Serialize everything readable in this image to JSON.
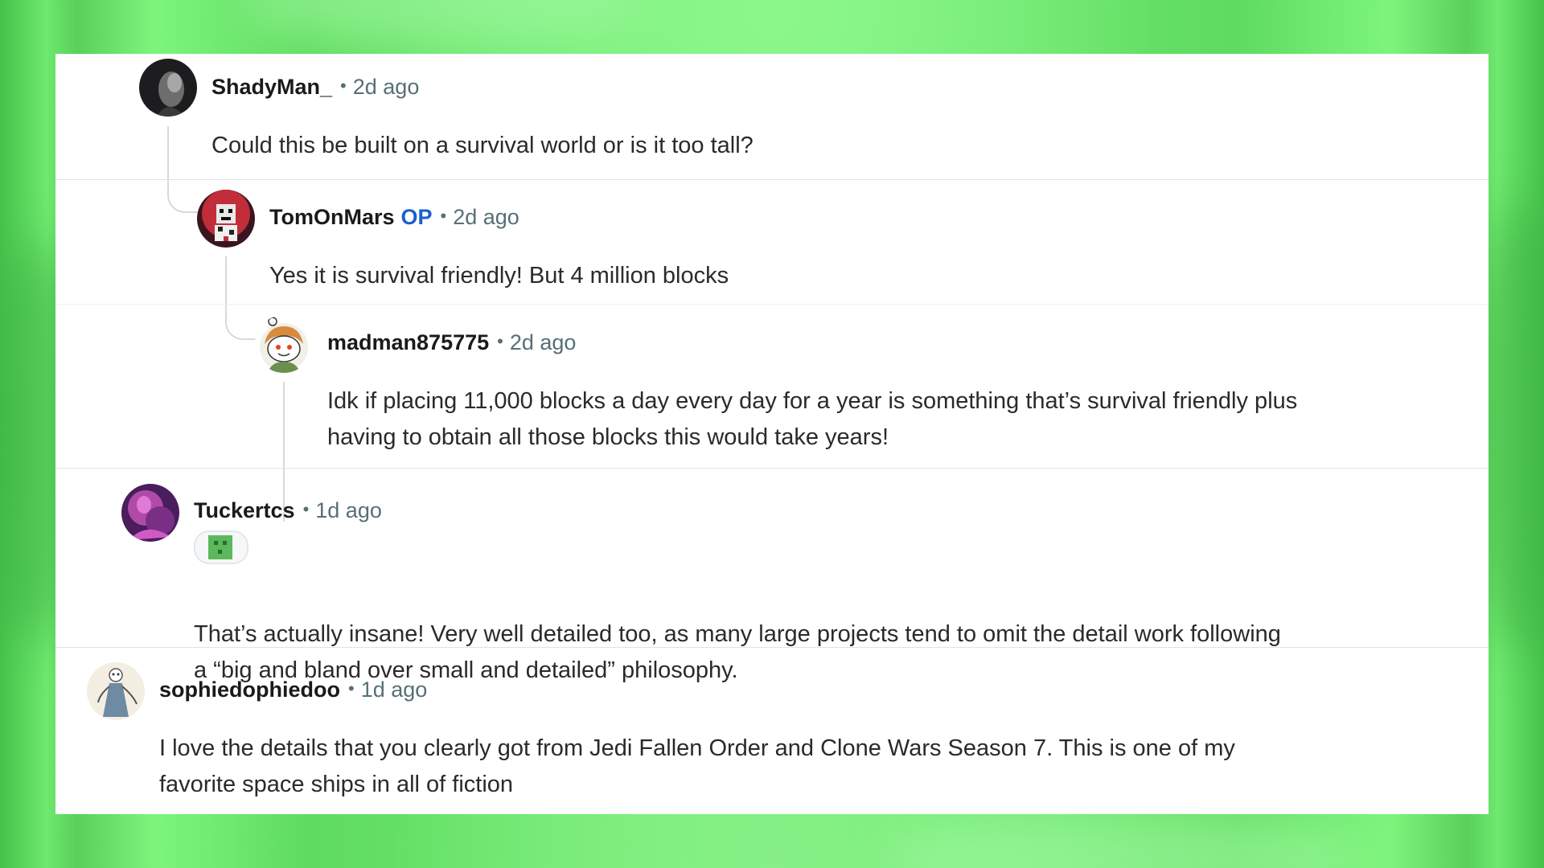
{
  "comments": [
    {
      "username": "ShadyMan_",
      "op_badge": "",
      "time": "2d ago",
      "text": "Could this be built on a survival world or is it too tall?",
      "avatar_icon": "dark-portrait-avatar"
    },
    {
      "username": "TomOnMars",
      "op_badge": "OP",
      "time": "2d ago",
      "text": "Yes it is survival friendly! But 4 million blocks",
      "avatar_icon": "red-pixel-avatar"
    },
    {
      "username": "madman875775",
      "op_badge": "",
      "time": "2d ago",
      "text_line1": "Idk if placing 11,000 blocks a day every day for a year is something that’s survival friendly plus",
      "text_line2": "having to obtain all those blocks this would take years!",
      "avatar_icon": "snoo-avatar"
    },
    {
      "username": "Tuckertcs",
      "op_badge": "",
      "time": "1d ago",
      "flair_icon": "green-block-flair-icon",
      "text_line1": "That’s actually insane! Very well detailed too, as many large projects tend to omit the detail work following",
      "text_line2": "a “big and bland over small and detailed” philosophy.",
      "avatar_icon": "purple-art-avatar"
    },
    {
      "username": "sophiedophiedoo",
      "op_badge": "",
      "time": "1d ago",
      "text_line1": "I love the details that you clearly got from Jedi Fallen Order and Clone Wars Season 7. This is one of my",
      "text_line2": "favorite space ships in all of fiction",
      "avatar_icon": "sketch-figure-avatar"
    }
  ],
  "separator": "•",
  "colors": {
    "background_green": "#6ee86e",
    "op_blue": "#1a5fce",
    "meta_gray": "#576f76"
  }
}
